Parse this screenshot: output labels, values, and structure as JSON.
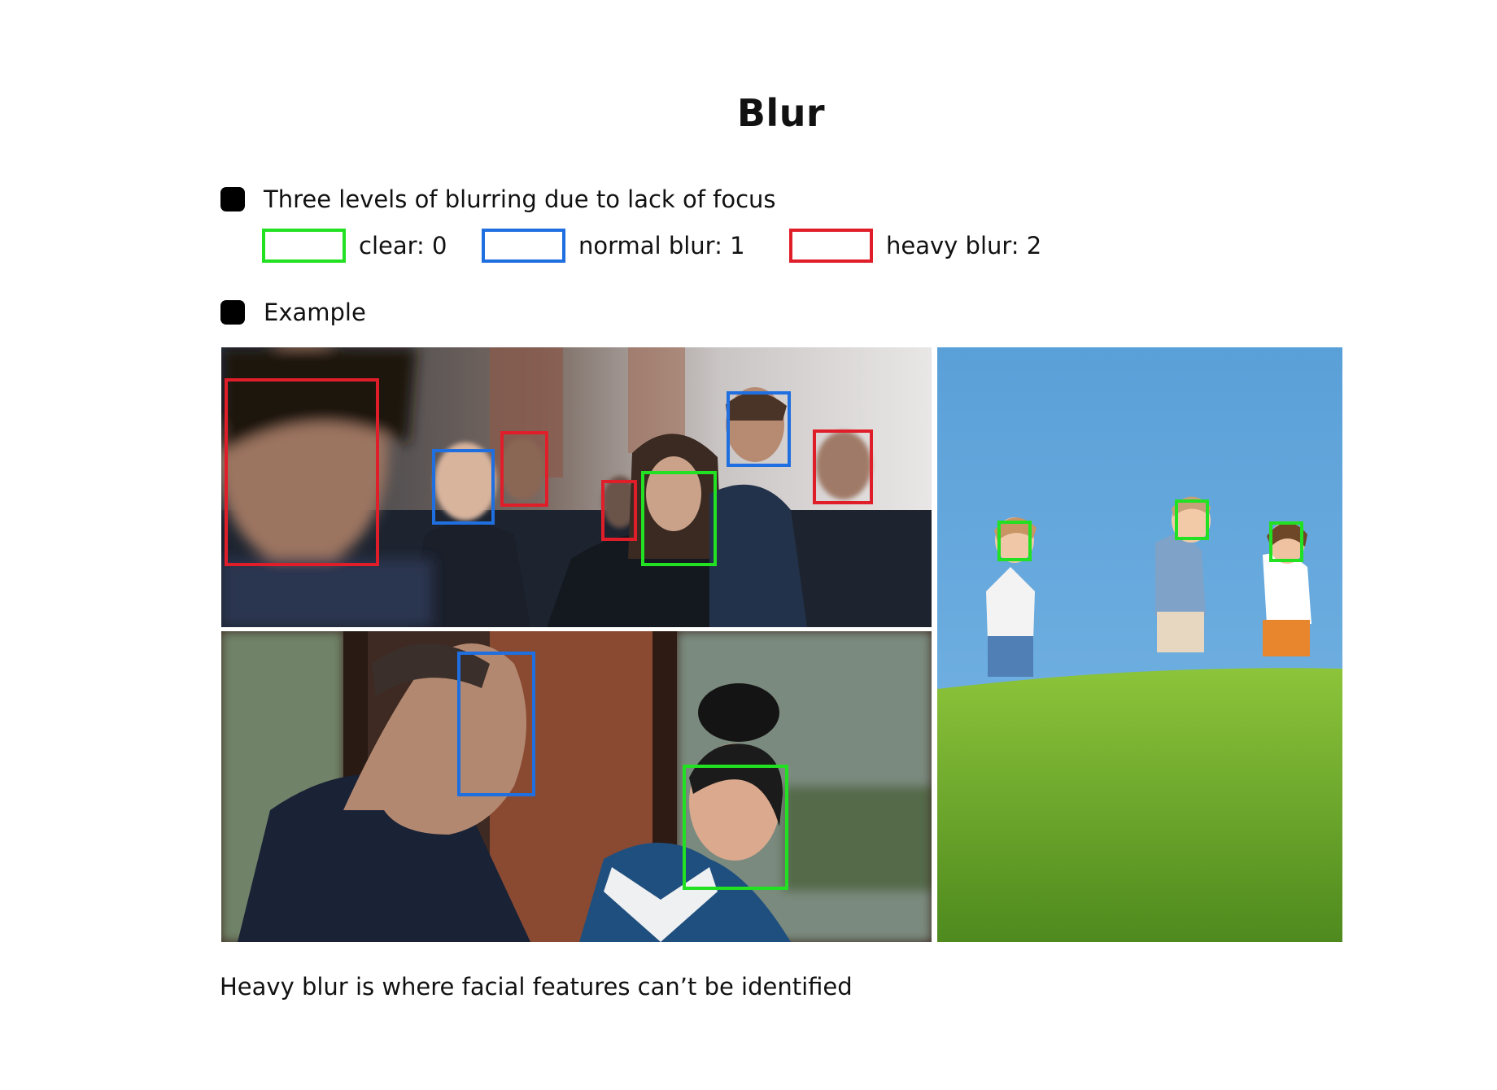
{
  "title": "Blur",
  "bullets": [
    {
      "text": "Three levels of blurring due to lack of focus"
    },
    {
      "text": "Example"
    }
  ],
  "legend": [
    {
      "label": "clear: 0",
      "color": "#22e022"
    },
    {
      "label": "normal blur: 1",
      "color": "#1f6fe0"
    },
    {
      "label": "heavy blur: 2",
      "color": "#e01e2a"
    }
  ],
  "caption": "Heavy blur is where facial features can’t be  identified",
  "examples": {
    "street_crowd": {
      "faces": [
        "heavy blur",
        "normal blur",
        "heavy blur",
        "heavy blur",
        "clear",
        "normal blur",
        "heavy blur"
      ]
    },
    "kimono_pair": {
      "faces": [
        "normal blur",
        "clear"
      ]
    },
    "kids_on_grass": {
      "faces": [
        "clear",
        "clear",
        "clear"
      ]
    }
  }
}
